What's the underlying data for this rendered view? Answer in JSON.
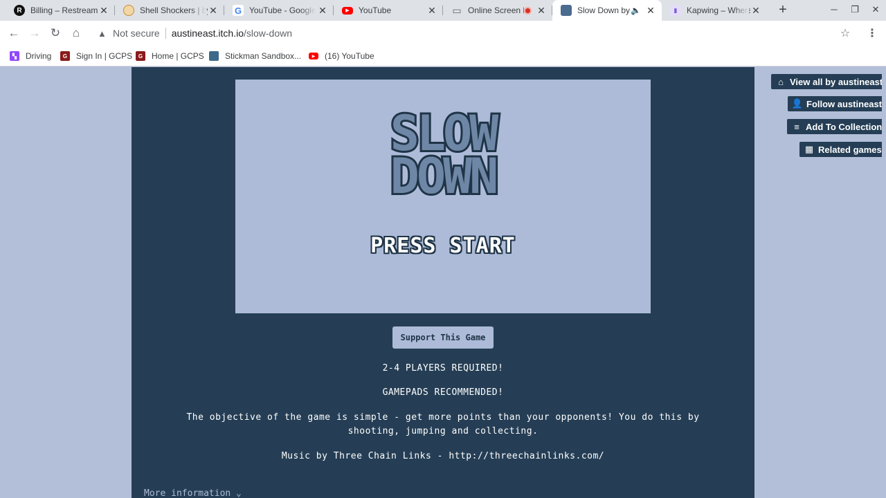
{
  "browser": {
    "tabs": [
      {
        "title": "Billing – Restream",
        "icon": "restream-icon",
        "icon_glyph": "R",
        "icon_color": "#111111"
      },
      {
        "title": "Shell Shockers | by",
        "icon": "egg-icon",
        "icon_glyph": "",
        "icon_color": "#e8a33d"
      },
      {
        "title": "YouTube - Google",
        "icon": "google-icon",
        "icon_glyph": "G",
        "icon_color": "#4285f4"
      },
      {
        "title": "YouTube",
        "icon": "youtube-icon",
        "icon_glyph": "▶",
        "icon_color": "#ff0000"
      },
      {
        "title": "Online Screen R",
        "icon": "monitor-icon",
        "icon_glyph": "▭",
        "icon_color": "#5f6368"
      },
      {
        "title": "Slow Down by",
        "icon": "itch-icon",
        "icon_glyph": "",
        "icon_color": "#4b6b8f"
      },
      {
        "title": "Kapwing – Where",
        "icon": "kapwing-icon",
        "icon_glyph": "",
        "icon_color": "#7b5cd6"
      }
    ],
    "active_tab_index": 5,
    "address": {
      "security_label": "Not secure",
      "host": "austineast.itch.io",
      "path": "/slow-down"
    },
    "bookmarks": [
      {
        "label": "Driving",
        "icon": "twitch-icon",
        "color": "#9146ff"
      },
      {
        "label": "Sign In | GCPS",
        "icon": "gcps-icon",
        "color": "#8b1a1a"
      },
      {
        "label": "Home | GCPS",
        "icon": "gcps-icon",
        "color": "#8b1a1a"
      },
      {
        "label": "Stickman Sandbox...",
        "icon": "stickman-icon",
        "color": "#3e6a8a"
      },
      {
        "label": "(16) YouTube",
        "icon": "youtube-icon",
        "color": "#ff0000"
      }
    ]
  },
  "game": {
    "logo_line1": "SLOW",
    "logo_line2": "DOWN",
    "press_start": "PRESS START"
  },
  "page": {
    "support_button": "Support This Game",
    "line1": "2-4 PLAYERS REQUIRED!",
    "line2": "GAMEPADS RECOMMENDED!",
    "line3": "The objective of the game is simple - get more points than your opponents! You do this by shooting, jumping and collecting.",
    "line4": "Music by Three Chain Links - http://threechainlinks.com/",
    "more_info": "More information ⌄"
  },
  "itch_sidebar": {
    "view_all": "View all by austineast",
    "follow": "Follow austineast",
    "add_collection": "Add To Collection",
    "related": "Related games"
  },
  "colors": {
    "panel": "#253e55",
    "game_bg": "#adbbd9",
    "page_bg": "#b3bfd9"
  }
}
